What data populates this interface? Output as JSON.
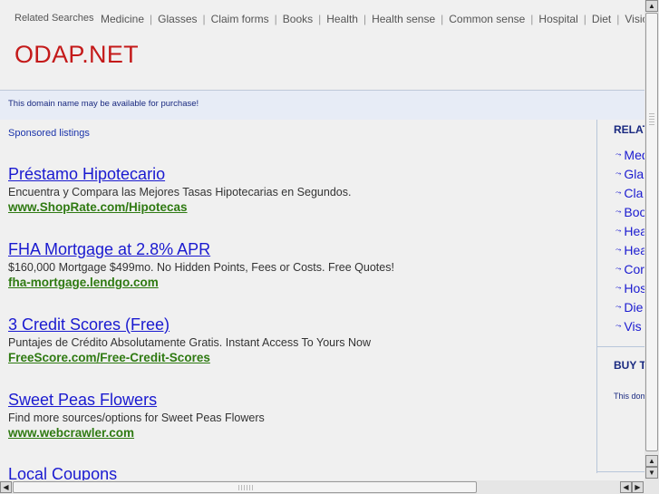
{
  "topbar": {
    "label": "Related Searches",
    "links": [
      "Medicine",
      "Glasses",
      "Claim forms",
      "Books",
      "Health",
      "Health sense",
      "Common sense",
      "Hospital",
      "Diet",
      "Vision"
    ]
  },
  "logo": "ODAP.NET",
  "availability": "This domain name may be available for purchase!",
  "sponsored_label": "Sponsored listings",
  "listings": [
    {
      "title": "Préstamo Hipotecario",
      "desc": "Encuentra y Compara las Mejores Tasas Hipotecarias en Segundos.",
      "url": "www.ShopRate.com/Hipotecas"
    },
    {
      "title": "FHA Mortgage at 2.8% APR",
      "desc": "$160,000 Mortgage $499mo. No Hidden Points, Fees or Costs. Free Quotes!",
      "url": "fha-mortgage.lendgo.com"
    },
    {
      "title": "3 Credit Scores (Free)",
      "desc": "Puntajes de Crédito Absolutamente Gratis. Instant Access To Yours Now",
      "url": "FreeScore.com/Free-Credit-Scores"
    },
    {
      "title": "Sweet Peas Flowers",
      "desc": "Find more sources/options for Sweet Peas Flowers",
      "url": "www.webcrawler.com"
    },
    {
      "title": "Local Coupons",
      "desc": "",
      "url": ""
    }
  ],
  "sidebar": {
    "heading": "RELAT",
    "items": [
      "Med",
      "Gla",
      "Cla",
      "Boo",
      "Hea",
      "Hea",
      "Cor",
      "Hos",
      "Die",
      "Vis"
    ],
    "buy_heading": "BUY T",
    "buy_text": "This dom"
  }
}
